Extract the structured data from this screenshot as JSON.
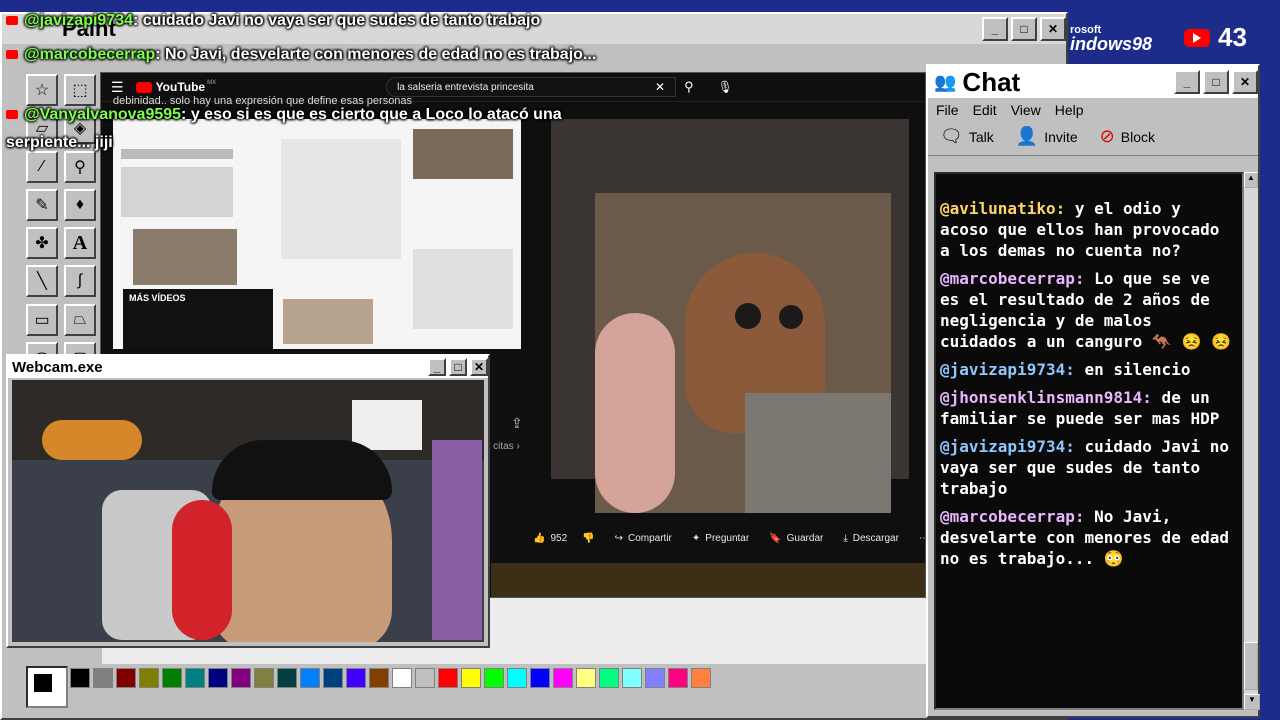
{
  "overlay_chat": [
    {
      "user": "@javizapi9734",
      "text": ": cuidado Javi no vaya ser que sudes de tanto trabajo"
    },
    {
      "user": "@marcobecerrap",
      "text": ": No Javi, desvelarte con menores de edad no es trabajo..."
    },
    {
      "user": "@Vanyalvanova9595",
      "text": ": y eso si es que es cierto que a Loco lo atacó una"
    },
    {
      "user": "",
      "text": "serpiente... jiji"
    }
  ],
  "paint": {
    "title": "Paint",
    "palette": [
      "#000000",
      "#808080",
      "#800000",
      "#808000",
      "#008000",
      "#008080",
      "#000080",
      "#800080",
      "#808040",
      "#004040",
      "#0080ff",
      "#004080",
      "#4000ff",
      "#804000",
      "#ffffff",
      "#c0c0c0",
      "#ff0000",
      "#ffff00",
      "#00ff00",
      "#00ffff",
      "#0000ff",
      "#ff00ff",
      "#ffff80",
      "#00ff80",
      "#80ffff",
      "#8080ff",
      "#ff0080",
      "#ff8040"
    ]
  },
  "youtube": {
    "logo": "YouTube",
    "region": "MX",
    "search_query": "la salseria entrevista princesita",
    "partial_caption": "debinidad.. solo hay una expresión que define esas personas",
    "more_videos": "MÁS VÍDEOS",
    "likes": "952",
    "share": "Compartir",
    "ask": "Preguntar",
    "save": "Guardar",
    "download": "Descargar",
    "citas": "r citas ›"
  },
  "webcam": {
    "title": "Webcam.exe"
  },
  "chat": {
    "title": "Chat",
    "menu": [
      "File",
      "Edit",
      "View",
      "Help"
    ],
    "toolbar": {
      "talk": "Talk",
      "invite": "Invite",
      "block": "Block"
    },
    "messages": [
      {
        "user": "@avilunatiko:",
        "text": " y el odio y acoso que ellos han provocado a los demas no cuenta no?",
        "color": "gold"
      },
      {
        "user": "@marcobecerrap:",
        "text": " Lo que se ve es el resultado de 2 años de negligencia y de malos cuidados a un canguro 🦘 😣 😣",
        "color": "pink"
      },
      {
        "user": "@javizapi9734:",
        "text": " en silencio",
        "color": "blue"
      },
      {
        "user": "@jhonsenklinsmann9814:",
        "text": " de un familiar se puede ser mas HDP",
        "color": "pink"
      },
      {
        "user": "@javizapi9734:",
        "text": " cuidado Javi no vaya ser que sudes de tanto trabajo",
        "color": "blue"
      },
      {
        "user": "@marcobecerrap:",
        "text": " No Javi, desvelarte con menores de edad no es trabajo... 😳",
        "color": "pink"
      }
    ]
  },
  "win98_logo": "indows98",
  "win98_logo_small": "rosoft",
  "viewers": "43"
}
